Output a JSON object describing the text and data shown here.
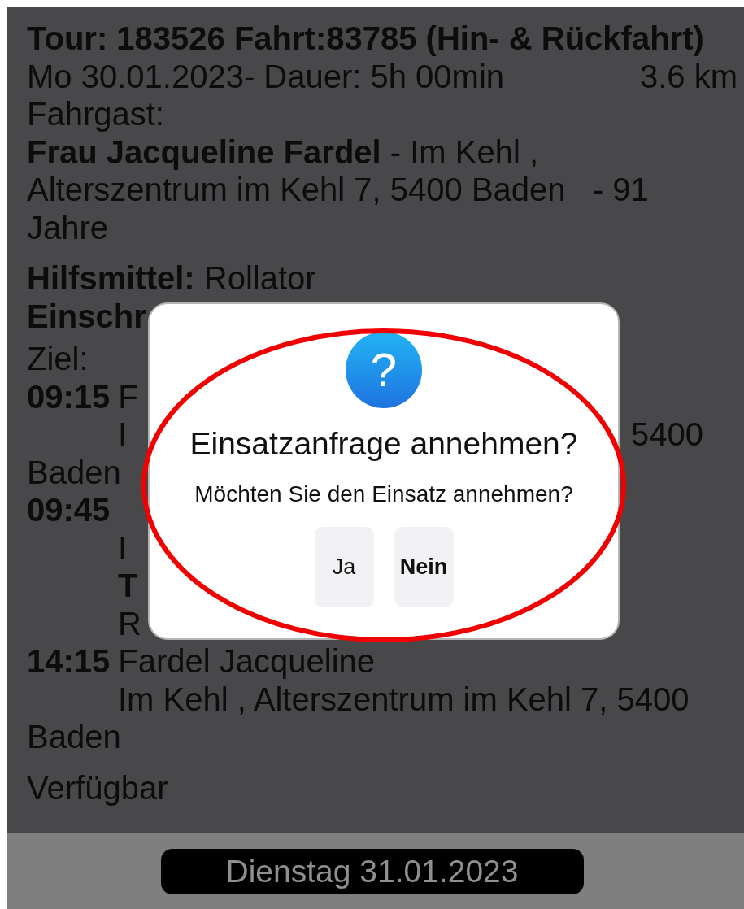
{
  "header": {
    "title": "Tour: 183526 Fahrt:83785 (Hin- & Rückfahrt)",
    "date_duration": "Mo 30.01.2023- Dauer: 5h 00min",
    "distance": "3.6 km",
    "passenger_label": "Fahrgast:",
    "passenger": "**Frau Jacqueline Fardel** - Im Kehl , Alterszentrum im Kehl 7, 5400 Baden   - 91 Jahre"
  },
  "aid": "**Hilfsmittel:** Rollator",
  "restriction": "Einschr",
  "destination_label": "Ziel:",
  "route_lines": [
    {
      "kind": "stop",
      "time": "09:15",
      "text": "F"
    },
    {
      "kind": "indent",
      "text": "I",
      "bold": false,
      "tail": "5400"
    },
    {
      "kind": "plain",
      "text": "Baden"
    },
    {
      "kind": "stop",
      "time": "09:45"
    },
    {
      "kind": "indent",
      "text": "I",
      "bold": false
    },
    {
      "kind": "indent",
      "text": "T",
      "bold": true
    },
    {
      "kind": "indent",
      "text": "R",
      "bold": false
    },
    {
      "kind": "stop",
      "time": "14:15",
      "text": "Fardel Jacqueline"
    },
    {
      "kind": "indent",
      "text": "Im Kehl , Alterszentrum im Kehl 7, 5400",
      "bold": false
    },
    {
      "kind": "plain",
      "text": "Baden"
    }
  ],
  "status": "Verfügbar",
  "footer": {
    "date_button": "Dienstag 31.01.2023"
  },
  "dialog": {
    "icon": "?",
    "title": "Einsatzanfrage annehmen?",
    "message": "Möchten Sie den Einsatz annehmen?",
    "buttons": [
      {
        "label": "Ja",
        "default": false
      },
      {
        "label": "Nein",
        "default": true
      }
    ]
  }
}
